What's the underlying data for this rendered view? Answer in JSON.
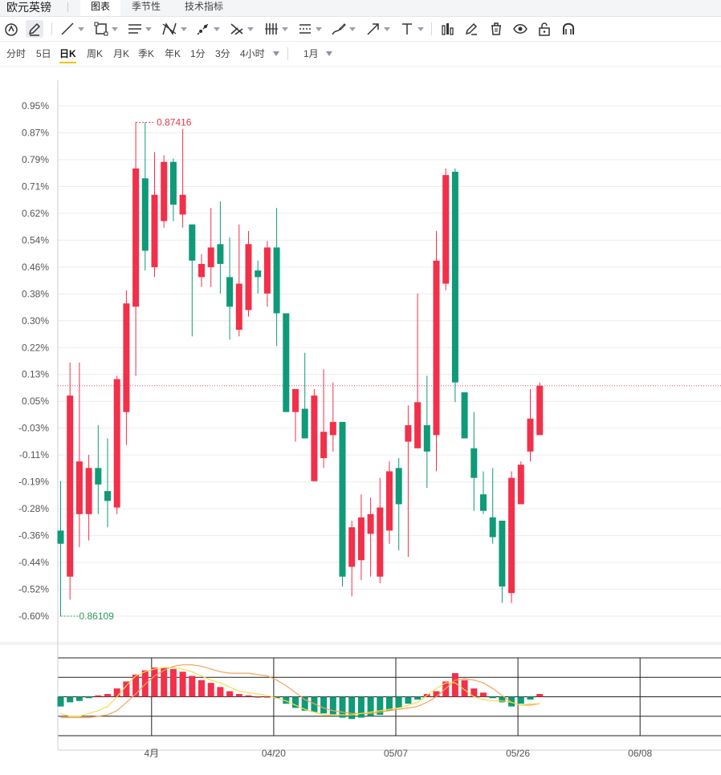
{
  "app": {
    "title": "欧元英镑",
    "tabs": [
      {
        "label": "图表",
        "active": true
      },
      {
        "label": "季节性",
        "active": false
      },
      {
        "label": "技术指标",
        "active": false
      }
    ]
  },
  "toolbar": {
    "tools": [
      {
        "name": "magnet-icon"
      },
      {
        "name": "pencil-icon",
        "active": true
      },
      {
        "name": "line-tool-icon",
        "caret": true
      },
      {
        "name": "rectangle-tool-icon",
        "caret": true
      },
      {
        "name": "parallel-channel-icon",
        "caret": true
      },
      {
        "name": "pattern-tool-icon",
        "caret": true
      },
      {
        "name": "ray-tool-icon",
        "caret": true
      },
      {
        "name": "cross-tool-icon",
        "caret": true
      },
      {
        "name": "fib-retracement-icon",
        "caret": true
      },
      {
        "name": "measure-tool-icon",
        "caret": true
      },
      {
        "name": "brush-tool-icon",
        "caret": true
      },
      {
        "name": "arrow-tool-icon",
        "caret": true
      },
      {
        "name": "text-tool-icon",
        "caret": true
      },
      {
        "name": "bar-chart-icon"
      },
      {
        "name": "edit-icon"
      },
      {
        "name": "trash-icon"
      },
      {
        "name": "eye-icon"
      },
      {
        "name": "unlock-icon"
      },
      {
        "name": "magnet-u-icon"
      }
    ]
  },
  "periods": {
    "items": [
      "分时",
      "5日",
      "日K",
      "周K",
      "月K",
      "季K",
      "年K",
      "1分",
      "3分",
      "4小时"
    ],
    "active": "日K",
    "range": "1月"
  },
  "colors": {
    "up": "#f2304a",
    "down": "#0f9a78",
    "grid": "#e9ebef",
    "dif": "#f0a35a",
    "dea": "#f2de4a"
  },
  "chart_data": {
    "type": "candlestick",
    "yticks": [
      "0.95%",
      "0.87%",
      "0.79%",
      "0.71%",
      "0.62%",
      "0.54%",
      "0.46%",
      "0.38%",
      "0.30%",
      "0.22%",
      "0.13%",
      "0.05%",
      "-0.03%",
      "-0.11%",
      "-0.19%",
      "-0.28%",
      "-0.36%",
      "-0.44%",
      "-0.52%",
      "-0.60%"
    ],
    "ylim": [
      -0.63,
      0.98
    ],
    "high_label": "0.87416",
    "low_label": "0.86109",
    "ref_line_pct": 0.1,
    "candles": [
      {
        "o": -0.34,
        "h": -0.19,
        "l": -0.6,
        "c": -0.38
      },
      {
        "o": -0.48,
        "h": 0.17,
        "l": -0.55,
        "c": 0.07
      },
      {
        "o": -0.29,
        "h": 0.17,
        "l": -0.39,
        "c": -0.13
      },
      {
        "o": -0.29,
        "h": -0.11,
        "l": -0.37,
        "c": -0.15
      },
      {
        "o": -0.15,
        "h": -0.02,
        "l": -0.29,
        "c": -0.2
      },
      {
        "o": -0.22,
        "h": -0.06,
        "l": -0.33,
        "c": -0.25
      },
      {
        "o": -0.27,
        "h": 0.13,
        "l": -0.29,
        "c": 0.12
      },
      {
        "o": 0.02,
        "h": 0.39,
        "l": -0.08,
        "c": 0.35
      },
      {
        "o": 0.34,
        "h": 0.9,
        "l": 0.13,
        "c": 0.76
      },
      {
        "o": 0.73,
        "h": 0.9,
        "l": 0.45,
        "c": 0.51
      },
      {
        "o": 0.46,
        "h": 0.81,
        "l": 0.43,
        "c": 0.68
      },
      {
        "o": 0.6,
        "h": 0.8,
        "l": 0.58,
        "c": 0.78
      },
      {
        "o": 0.78,
        "h": 0.79,
        "l": 0.6,
        "c": 0.65
      },
      {
        "o": 0.62,
        "h": 0.88,
        "l": 0.58,
        "c": 0.68
      },
      {
        "o": 0.59,
        "h": 0.59,
        "l": 0.25,
        "c": 0.48
      },
      {
        "o": 0.43,
        "h": 0.5,
        "l": 0.4,
        "c": 0.47
      },
      {
        "o": 0.46,
        "h": 0.64,
        "l": 0.4,
        "c": 0.52
      },
      {
        "o": 0.53,
        "h": 0.66,
        "l": 0.38,
        "c": 0.47
      },
      {
        "o": 0.43,
        "h": 0.55,
        "l": 0.24,
        "c": 0.34
      },
      {
        "o": 0.27,
        "h": 0.59,
        "l": 0.25,
        "c": 0.41
      },
      {
        "o": 0.33,
        "h": 0.57,
        "l": 0.31,
        "c": 0.53
      },
      {
        "o": 0.45,
        "h": 0.48,
        "l": 0.38,
        "c": 0.43
      },
      {
        "o": 0.38,
        "h": 0.54,
        "l": 0.34,
        "c": 0.52
      },
      {
        "o": 0.52,
        "h": 0.64,
        "l": 0.22,
        "c": 0.32
      },
      {
        "o": 0.32,
        "h": 0.32,
        "l": 0.03,
        "c": 0.02
      },
      {
        "o": 0.02,
        "h": 0.08,
        "l": -0.07,
        "c": 0.09
      },
      {
        "o": 0.03,
        "h": 0.2,
        "l": -0.05,
        "c": -0.06
      },
      {
        "o": -0.19,
        "h": 0.09,
        "l": -0.19,
        "c": 0.07
      },
      {
        "o": -0.12,
        "h": 0.15,
        "l": -0.15,
        "c": -0.04
      },
      {
        "o": -0.05,
        "h": 0.11,
        "l": -0.1,
        "c": -0.01
      },
      {
        "o": -0.01,
        "h": -0.01,
        "l": -0.51,
        "c": -0.48
      },
      {
        "o": -0.45,
        "h": -0.31,
        "l": -0.54,
        "c": -0.33
      },
      {
        "o": -0.43,
        "h": -0.23,
        "l": -0.49,
        "c": -0.3
      },
      {
        "o": -0.35,
        "h": -0.24,
        "l": -0.48,
        "c": -0.29
      },
      {
        "o": -0.48,
        "h": -0.18,
        "l": -0.5,
        "c": -0.27
      },
      {
        "o": -0.34,
        "h": -0.13,
        "l": -0.38,
        "c": -0.16
      },
      {
        "o": -0.15,
        "h": -0.12,
        "l": -0.4,
        "c": -0.26
      },
      {
        "o": -0.07,
        "h": 0.04,
        "l": -0.42,
        "c": -0.02
      },
      {
        "o": -0.09,
        "h": 0.38,
        "l": -0.09,
        "c": 0.05
      },
      {
        "o": -0.02,
        "h": 0.13,
        "l": -0.21,
        "c": -0.1
      },
      {
        "o": -0.05,
        "h": 0.57,
        "l": -0.16,
        "c": 0.48
      },
      {
        "o": 0.41,
        "h": 0.76,
        "l": 0.39,
        "c": 0.74
      },
      {
        "o": 0.75,
        "h": 0.76,
        "l": 0.05,
        "c": 0.11
      },
      {
        "o": 0.08,
        "h": 0.08,
        "l": -0.06,
        "c": -0.06
      },
      {
        "o": -0.09,
        "h": 0.02,
        "l": -0.28,
        "c": -0.18
      },
      {
        "o": -0.23,
        "h": -0.16,
        "l": -0.29,
        "c": -0.28
      },
      {
        "o": -0.3,
        "h": -0.15,
        "l": -0.38,
        "c": -0.36
      },
      {
        "o": -0.31,
        "h": -0.31,
        "l": -0.56,
        "c": -0.51
      },
      {
        "o": -0.53,
        "h": -0.16,
        "l": -0.56,
        "c": -0.18
      },
      {
        "o": -0.26,
        "h": -0.13,
        "l": -0.26,
        "c": -0.14
      },
      {
        "o": -0.1,
        "h": 0.09,
        "l": -0.13,
        "c": 0.0
      },
      {
        "o": -0.05,
        "h": 0.11,
        "l": -0.05,
        "c": 0.1
      }
    ],
    "macd": {
      "hist": [
        -0.7,
        -0.4,
        -0.3,
        -0.1,
        0.1,
        0.2,
        0.6,
        1.1,
        1.6,
        1.9,
        2.1,
        2.1,
        2.0,
        1.8,
        1.5,
        1.2,
        1.0,
        0.7,
        0.4,
        0.2,
        0.1,
        0.0,
        0.0,
        -0.1,
        -0.5,
        -0.8,
        -1.0,
        -1.1,
        -1.2,
        -1.3,
        -1.5,
        -1.6,
        -1.5,
        -1.4,
        -1.3,
        -1.0,
        -0.8,
        -0.5,
        -0.2,
        0.2,
        0.4,
        1.1,
        1.7,
        1.2,
        0.6,
        0.3,
        -0.1,
        -0.4,
        -0.7,
        -0.5,
        -0.2,
        0.2
      ],
      "dif": [
        -1.5,
        -1.5,
        -1.5,
        -1.5,
        -1.4,
        -1.3,
        -1.0,
        -0.4,
        0.2,
        0.9,
        1.5,
        1.9,
        2.2,
        2.3,
        2.3,
        2.2,
        2.0,
        1.8,
        1.7,
        1.7,
        1.7,
        1.6,
        1.5,
        1.2,
        0.8,
        0.3,
        -0.2,
        -0.5,
        -0.8,
        -1.0,
        -1.1,
        -1.2,
        -1.2,
        -1.2,
        -1.1,
        -1.0,
        -0.9,
        -0.8,
        -0.7,
        -0.4,
        0.0,
        0.6,
        1.2,
        1.3,
        1.2,
        1.0,
        0.6,
        0.1,
        -0.4,
        -0.6,
        -0.6,
        -0.5
      ],
      "dea": [
        -1.2,
        -1.4,
        -1.4,
        -1.2,
        -1.0,
        -0.7,
        0.0,
        0.8,
        1.5,
        1.8,
        2.0,
        2.1,
        2.1,
        2.0,
        1.8,
        1.5,
        1.2,
        1.0,
        0.7,
        0.4,
        0.3,
        0.2,
        0.1,
        -0.1,
        -0.3,
        -0.6,
        -0.9,
        -1.1,
        -1.3,
        -1.3,
        -1.3,
        -1.3,
        -1.2,
        -1.1,
        -1.0,
        -0.9,
        -0.8,
        -0.6,
        -0.4,
        0.1,
        0.6,
        1.0,
        1.0,
        0.5,
        0.0,
        -0.2,
        -0.3,
        -0.3,
        -0.4,
        -0.6,
        -0.5,
        -0.5
      ],
      "ylim": [
        -2.8,
        2.8
      ]
    },
    "xlabels": [
      {
        "index": 9,
        "label": "4月"
      },
      {
        "index": 22,
        "label": "04/20"
      },
      {
        "index": 35,
        "label": "05/07"
      },
      {
        "index": 48,
        "label": "05/26"
      },
      {
        "index": 61,
        "label": "06/08"
      }
    ]
  }
}
